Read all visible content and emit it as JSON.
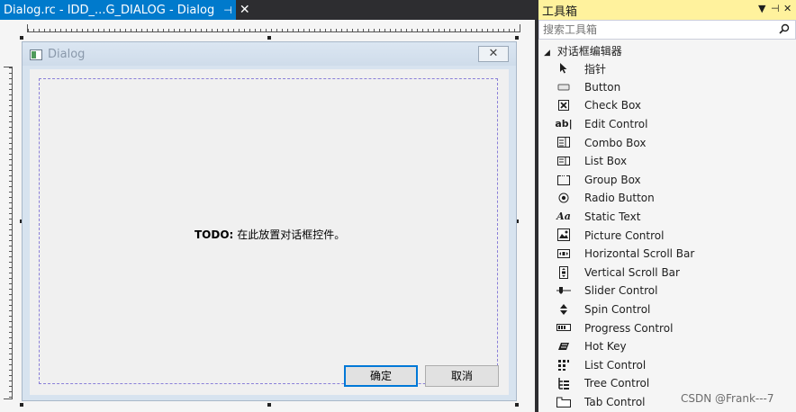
{
  "document_tab": {
    "title": "Dialog.rc - IDD_...G_DIALOG - Dialog",
    "pin_glyph": "⊣",
    "close_glyph": "✕"
  },
  "dialog": {
    "title": "Dialog",
    "close_glyph": "✕",
    "todo_prefix": "TODO:",
    "todo_text": "在此放置对话框控件。",
    "ok_label": "确定",
    "cancel_label": "取消"
  },
  "toolbox": {
    "title": "工具箱",
    "dropdown_glyph": "▼",
    "pin_glyph": "⊣",
    "close_glyph": "✕",
    "search_placeholder": "搜索工具箱",
    "group_label": "对话框编辑器",
    "items": [
      {
        "label": "指针",
        "icon": "pointer-icon"
      },
      {
        "label": "Button",
        "icon": "button-icon"
      },
      {
        "label": "Check Box",
        "icon": "checkbox-icon"
      },
      {
        "label": "Edit Control",
        "icon": "edit-control-icon"
      },
      {
        "label": "Combo Box",
        "icon": "combo-box-icon"
      },
      {
        "label": "List Box",
        "icon": "list-box-icon"
      },
      {
        "label": "Group Box",
        "icon": "group-box-icon"
      },
      {
        "label": "Radio Button",
        "icon": "radio-button-icon"
      },
      {
        "label": "Static Text",
        "icon": "static-text-icon"
      },
      {
        "label": "Picture Control",
        "icon": "picture-control-icon"
      },
      {
        "label": "Horizontal Scroll Bar",
        "icon": "hscroll-icon"
      },
      {
        "label": "Vertical Scroll Bar",
        "icon": "vscroll-icon"
      },
      {
        "label": "Slider Control",
        "icon": "slider-icon"
      },
      {
        "label": "Spin Control",
        "icon": "spin-icon"
      },
      {
        "label": "Progress Control",
        "icon": "progress-icon"
      },
      {
        "label": "Hot Key",
        "icon": "hotkey-icon"
      },
      {
        "label": "List Control",
        "icon": "list-control-icon"
      },
      {
        "label": "Tree Control",
        "icon": "tree-control-icon"
      },
      {
        "label": "Tab Control",
        "icon": "tab-control-icon"
      }
    ]
  },
  "watermark": "CSDN @Frank---7",
  "colors": {
    "active_tab": "#007acc",
    "toolbox_header": "#fff29d",
    "default_button_border": "#0078d7",
    "guide_border": "#8a7fd8"
  }
}
